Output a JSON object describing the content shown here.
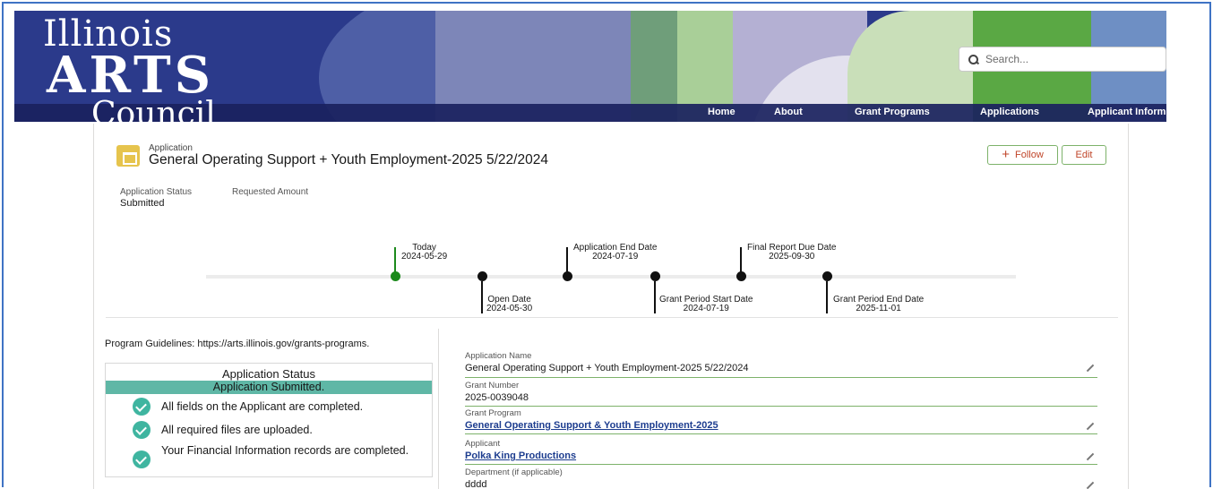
{
  "header": {
    "logo": {
      "line1": "Illinois",
      "line2": "ARTS",
      "line3": "Council"
    },
    "search": {
      "placeholder": "Search..."
    },
    "nav": [
      {
        "label": "Home"
      },
      {
        "label": "About"
      },
      {
        "label": "Grant Programs"
      },
      {
        "label": "Applications"
      },
      {
        "label": "Applicant Inform"
      }
    ]
  },
  "record": {
    "type": "Application",
    "title": "General Operating Support + Youth Employment-2025 5/22/2024",
    "icon": "application-icon",
    "follow_label": "Follow",
    "edit_label": "Edit",
    "highlights": [
      {
        "label": "Application Status",
        "value": "Submitted"
      },
      {
        "label": "Requested Amount",
        "value": ""
      }
    ]
  },
  "timeline": [
    {
      "name": "Today",
      "date": "2024-05-29",
      "position": "above",
      "color": "#1c8a1c"
    },
    {
      "name": "Open Date",
      "date": "2024-05-30",
      "position": "below"
    },
    {
      "name": "Application End Date",
      "date": "2024-07-19",
      "position": "above"
    },
    {
      "name": "Grant Period Start Date",
      "date": "2024-07-19",
      "position": "below"
    },
    {
      "name": "Final Report Due Date",
      "date": "2025-09-30",
      "position": "above"
    },
    {
      "name": "Grant Period End Date",
      "date": "2025-11-01",
      "position": "below"
    }
  ],
  "status_panel": {
    "guidelines": "Program Guidelines: https://arts.illinois.gov/grants-programs.",
    "title": "Application Status",
    "banner": "Application Submitted.",
    "checks": [
      "All fields on the Applicant are completed.",
      "All required files are uploaded.",
      "Your Financial Information records are completed."
    ]
  },
  "fields": [
    {
      "label": "Application Name",
      "value": "General Operating Support + Youth Employment-2025 5/22/2024",
      "link": false,
      "editable": true
    },
    {
      "label": "Grant Number",
      "value": "2025-0039048",
      "link": false,
      "editable": false
    },
    {
      "label": "Grant Program",
      "value": "General Operating Support & Youth Employment-2025",
      "link": true,
      "editable": true
    },
    {
      "label": "Applicant",
      "value": "Polka King Productions",
      "link": true,
      "editable": true
    },
    {
      "label": "Department (if applicable)",
      "value": "dddd",
      "link": false,
      "editable": true
    }
  ],
  "colors": {
    "banner": "#2b3a8b",
    "accent_green": "#7db26a",
    "status_teal": "#5fb7a6",
    "button_text": "#c0462a",
    "today_marker": "#1c8a1c"
  }
}
